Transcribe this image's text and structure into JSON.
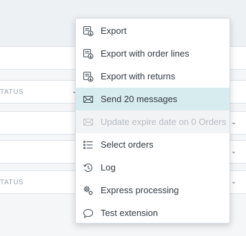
{
  "background": {
    "filter_rows": [
      {
        "label": "TATUS"
      },
      {
        "label": ""
      },
      {
        "label": ""
      },
      {
        "label": "TATUS"
      }
    ]
  },
  "menu": {
    "items": [
      {
        "label": "Export",
        "icon": "export-icon",
        "state": "normal"
      },
      {
        "label": "Export with order lines",
        "icon": "export-order-lines-icon",
        "state": "normal"
      },
      {
        "label": "Export with returns",
        "icon": "export-returns-icon",
        "state": "normal"
      },
      {
        "label": "Send 20 messages",
        "icon": "envelope-icon",
        "state": "highlighted"
      },
      {
        "label": "Update expire date on 0 Orders",
        "icon": "envelope-icon",
        "state": "disabled"
      },
      {
        "label": "Select orders",
        "icon": "list-icon",
        "state": "normal"
      },
      {
        "label": "Log",
        "icon": "history-icon",
        "state": "normal"
      },
      {
        "label": "Express processing",
        "icon": "gears-icon",
        "state": "normal"
      },
      {
        "label": "Test extension",
        "icon": "chat-bubble-icon",
        "state": "normal"
      }
    ]
  },
  "colors": {
    "highlight": "#d7ecee",
    "disabled_bg": "#f2f3f4",
    "disabled_text": "#b6bcc2"
  }
}
